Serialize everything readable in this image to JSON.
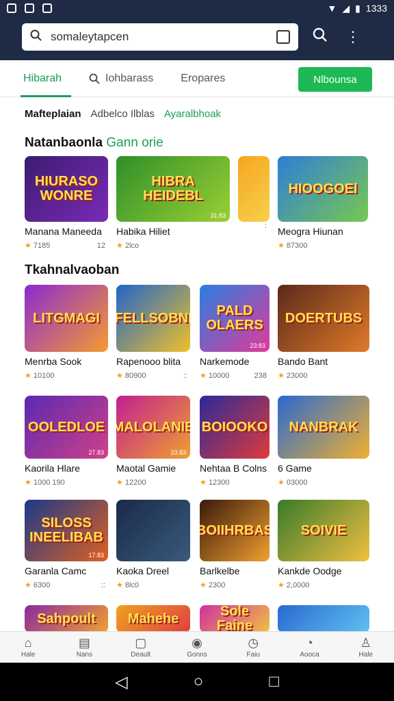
{
  "status": {
    "time": "1333"
  },
  "search": {
    "query": "somaleytapcen"
  },
  "tabs": [
    {
      "label": "Hibarah"
    },
    {
      "label": "Iohbarass"
    },
    {
      "label": "Eropares"
    }
  ],
  "install_button": "Nlbounsa",
  "chips": [
    "Mafteplaian",
    "Adbelco Ilblas",
    "Ayaralbhoak"
  ],
  "sections": {
    "featured_title": "Natanbaonla",
    "featured_accent": "Gann orie",
    "second_title": "Tkahnalvaoban"
  },
  "featured": [
    {
      "art": "HIURASO WONRE",
      "name": "Manana Maneeda",
      "rating": "7185",
      "side": "12",
      "colors": [
        "#3a1d6e",
        "#7c2ab8"
      ]
    },
    {
      "art": "HIBRA HEIDEBL",
      "name": "Habika Hiliet",
      "rating": "2lco",
      "side": "",
      "badge": "31:83",
      "colors": [
        "#2f8f2a",
        "#9ad033"
      ]
    },
    {
      "art": "",
      "name": "",
      "rating": "",
      "side": ":",
      "colors": [
        "#f5a623",
        "#f7d04a"
      ]
    },
    {
      "art": "HIOOGOEl",
      "name": "Meogra Hiunan",
      "rating": "87300",
      "side": "",
      "colors": [
        "#2e7ed8",
        "#78c850"
      ]
    }
  ],
  "games": [
    {
      "art": "LITGMAGI",
      "name": "Menrba Sook",
      "rating": "10100",
      "side": "",
      "colors": [
        "#8b2bd1",
        "#f59b2f"
      ]
    },
    {
      "art": "FELLSOBNI",
      "name": "Rapenooo blita",
      "rating": "80900",
      "side": "::",
      "colors": [
        "#2065c9",
        "#f0c02a"
      ]
    },
    {
      "art": "PALD OLAERS",
      "name": "Narkemode",
      "rating": "10000",
      "side": "238",
      "badge": "23:83",
      "colors": [
        "#2a7fe0",
        "#e03a9a"
      ]
    },
    {
      "art": "DOERTUBS",
      "name": "Bando Bant",
      "rating": "23000",
      "side": "",
      "colors": [
        "#5a2a1a",
        "#e07a2a"
      ]
    },
    {
      "art": "OOLEDLOE",
      "name": "Kaorila Hlare",
      "rating": "1000 190",
      "side": "",
      "badge": "27.83",
      "colors": [
        "#5a2ab0",
        "#d0408a"
      ]
    },
    {
      "art": "MALOLANIE",
      "name": "Maotal Gamie",
      "rating": "12200",
      "side": "",
      "badge": "23.83",
      "colors": [
        "#c02090",
        "#f0a030"
      ]
    },
    {
      "art": "BOIOOKO",
      "name": "Nehtaa B Colns",
      "rating": "12300",
      "side": "",
      "colors": [
        "#2a2a9a",
        "#e03a3a"
      ]
    },
    {
      "art": "NANBRAK",
      "name": "6 Game",
      "rating": "03000",
      "side": "",
      "colors": [
        "#2a6ad0",
        "#f0b030"
      ]
    },
    {
      "art": "SILOSS INEELIBAB",
      "name": "Garanla Camc",
      "rating": "6300",
      "side": "::",
      "badge": "17.83",
      "colors": [
        "#1a3a8a",
        "#e06020"
      ]
    },
    {
      "art": "",
      "name": "Kaoka Dreel",
      "rating": "8lc0",
      "side": "",
      "colors": [
        "#1a2a4a",
        "#3a5a7a"
      ]
    },
    {
      "art": "BOIIHRBAS",
      "name": "Barlkelbe",
      "rating": "2300",
      "side": "",
      "colors": [
        "#3a1a0a",
        "#f0a030"
      ]
    },
    {
      "art": "SOIVIE",
      "name": "Kankde Oodge",
      "rating": "2,0000",
      "side": "",
      "colors": [
        "#3a7a2a",
        "#f0c040"
      ]
    }
  ],
  "peek": [
    {
      "art": "Sahpoult",
      "colors": [
        "#8a2aa0",
        "#f0a030"
      ]
    },
    {
      "art": "Mahehe",
      "colors": [
        "#f0a020",
        "#e04040"
      ]
    },
    {
      "art": "Sole Faine",
      "colors": [
        "#d030a0",
        "#f0c040"
      ]
    },
    {
      "art": "",
      "colors": [
        "#2a6ad0",
        "#60c0f0"
      ]
    }
  ],
  "bottom_nav": [
    {
      "label": "Hale",
      "icon": "home-icon"
    },
    {
      "label": "Nans",
      "icon": "news-icon"
    },
    {
      "label": "Deault",
      "icon": "chat-icon"
    },
    {
      "label": "Gonns",
      "icon": "compass-icon"
    },
    {
      "label": "Faiu",
      "icon": "clock-icon"
    },
    {
      "label": "Aooca",
      "icon": "alarm-icon"
    },
    {
      "label": "Hale",
      "icon": "person-icon"
    }
  ],
  "accent_color": "#1a9d5a"
}
